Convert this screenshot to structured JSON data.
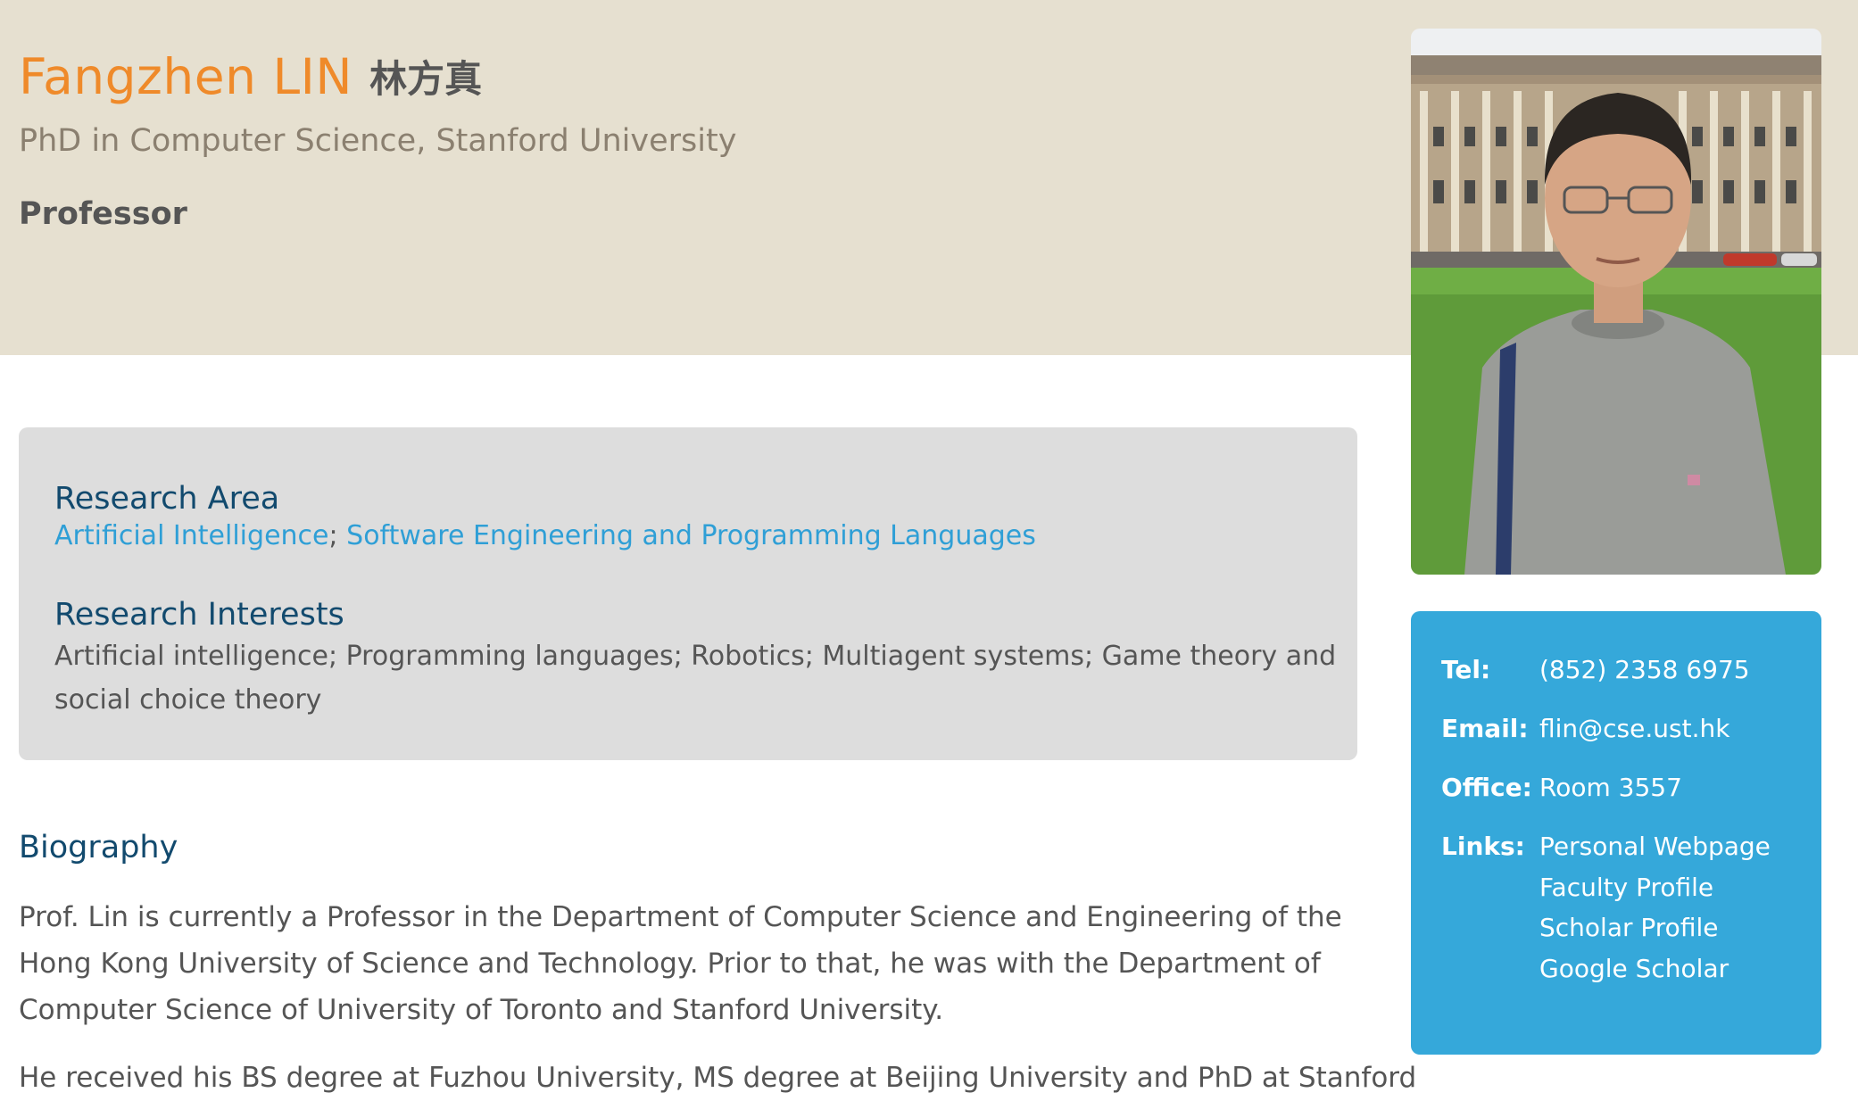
{
  "header": {
    "name_en": "Fangzhen LIN",
    "name_cn": "林方真",
    "degree": "PhD in Computer Science, Stanford University",
    "position": "Professor"
  },
  "research": {
    "area_heading": "Research Area",
    "areas": [
      "Artificial Intelligence",
      "Software Engineering and Programming Languages"
    ],
    "area_separator": ";",
    "interests_heading": "Research Interests",
    "interests": "Artificial intelligence; Programming languages; Robotics; Multiagent systems; Game theory and social choice theory"
  },
  "biography": {
    "heading": "Biography",
    "paragraphs": [
      "Prof. Lin is currently a Professor in the Department of Computer Science and Engineering of the Hong Kong University of Science and Technology. Prior to that, he was with the Department of Computer Science of University of Toronto and Stanford University.",
      "He received his BS degree at Fuzhou University, MS degree at Beijing University and PhD at Stanford"
    ]
  },
  "contact": {
    "tel_label": "Tel:",
    "tel": "(852) 2358 6975",
    "email_label": "Email:",
    "email": "flin@cse.ust.hk",
    "office_label": "Office:",
    "office": "Room 3557",
    "links_label": "Links:",
    "links": [
      "Personal Webpage",
      "Faculty Profile",
      "Scholar Profile",
      "Google Scholar"
    ]
  },
  "colors": {
    "header_bg": "#e6e0d0",
    "name": "#ef8a2a",
    "heading": "#124a6e",
    "link": "#2f9fd6",
    "contact_bg": "#35a8da",
    "research_bg": "#dddddd"
  },
  "photo": {
    "icon": "portrait-photo"
  }
}
